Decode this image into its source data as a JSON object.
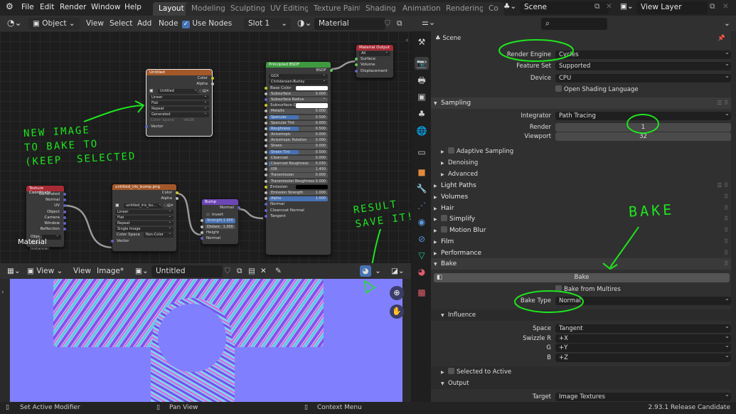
{
  "topbar": {
    "menus": [
      "File",
      "Edit",
      "Render",
      "Window",
      "Help"
    ],
    "workspaces": [
      {
        "label": "Layout",
        "active": true
      },
      {
        "label": "Modeling"
      },
      {
        "label": "Sculpting"
      },
      {
        "label": "UV Editing"
      },
      {
        "label": "Texture Paint"
      },
      {
        "label": "Shading"
      },
      {
        "label": "Animation"
      },
      {
        "label": "Rendering"
      },
      {
        "label": "Co"
      }
    ],
    "scene": "Scene",
    "view_layer": "View Layer"
  },
  "node_header": {
    "mode": "Object",
    "menus": [
      "View",
      "Select",
      "Add",
      "Node"
    ],
    "use_nodes_label": "Use Nodes",
    "use_nodes": true,
    "slot": "Slot 1",
    "material": "Material"
  },
  "nodes": {
    "untitled": {
      "title": "Untitled",
      "outputs": [
        "Color",
        "Alpha"
      ],
      "image": "Untitled",
      "interpolation": "Linear",
      "projection": "Flat",
      "extension": "Repeat",
      "source": "Generated",
      "color_space_label": "Color Space",
      "color_space": "sRGB",
      "input": "Vector"
    },
    "principled": {
      "title": "Principled BSDF",
      "output": "BSDF",
      "distribution": "GGX",
      "subsurface_method": "Christensen-Burley",
      "rows": [
        {
          "label": "Base Color",
          "type": "color"
        },
        {
          "label": "Subsurface",
          "value": "0.000"
        },
        {
          "label": "Subsurface Radius",
          "type": "dd"
        },
        {
          "label": "Subsurface C...",
          "type": "color"
        },
        {
          "label": "Metallic",
          "value": "0.000"
        },
        {
          "label": "Specular",
          "value": "0.500",
          "fill": 0.5
        },
        {
          "label": "Specular Tint",
          "value": "0.000"
        },
        {
          "label": "Roughness",
          "value": "0.500",
          "fill": 0.5
        },
        {
          "label": "Anisotropic",
          "value": "0.000"
        },
        {
          "label": "Anisotropic Rotation",
          "value": "0.000"
        },
        {
          "label": "Sheen",
          "value": "0.000"
        },
        {
          "label": "Sheen Tint",
          "value": "0.500",
          "fill": 0.5
        },
        {
          "label": "Clearcoat",
          "value": "0.000"
        },
        {
          "label": "Clearcoat Roughness",
          "value": "0.030",
          "fill": 0.03
        },
        {
          "label": "IOR",
          "value": "1.450"
        },
        {
          "label": "Transmission",
          "value": "0.000"
        },
        {
          "label": "Transmission Roughness",
          "value": "0.000"
        },
        {
          "label": "Emission",
          "type": "black"
        },
        {
          "label": "Emission Strength",
          "value": "1.000"
        },
        {
          "label": "Alpha",
          "value": "1.000",
          "fill": 1
        },
        {
          "label": "Normal",
          "type": "plain"
        },
        {
          "label": "Clearcoat Normal",
          "type": "plain"
        },
        {
          "label": "Tangent",
          "type": "plain"
        }
      ]
    },
    "output": {
      "title": "Material Output",
      "target": "All",
      "inputs": [
        "Surface",
        "Volume",
        "Displacement"
      ]
    },
    "texcoord": {
      "title": "Texture Coordinate",
      "outputs": [
        "Generated",
        "Normal",
        "UV",
        "Object",
        "Camera",
        "Window",
        "Reflection"
      ],
      "object_label": "Obje...",
      "from_instancer": "From Instancer"
    },
    "bumpimg": {
      "title": "untitled_iris_bump.png",
      "outputs": [
        "Color",
        "Alpha"
      ],
      "image": "untitled_iris_bu...",
      "interpolation": "Linear",
      "projection": "Flat",
      "extension": "Repeat",
      "source": "Single Image",
      "color_space_label": "Color Space",
      "color_space": "Non-Color",
      "input": "Vector"
    },
    "bump": {
      "title": "Bump",
      "output": "Normal",
      "invert": "Invert",
      "strength_label": "Strength",
      "strength": "1.000",
      "distance_label": "Distanc",
      "distance": "1.000",
      "inputs": [
        "Height",
        "Normal"
      ]
    }
  },
  "node_canvas_label": "Material",
  "annotations": {
    "new_image": "NEW IMAGE\nTO BAKE TO\n(KEEP  SELECTED",
    "result": "RESULT\nSAVE IT!",
    "bake": "BAKE"
  },
  "image_header": {
    "menus": [
      "View",
      "View",
      "Image*"
    ],
    "image_name": "Untitled"
  },
  "properties": {
    "context": "Scene",
    "render_engine_label": "Render Engine",
    "render_engine": "Cycles",
    "feature_set_label": "Feature Set",
    "feature_set": "Supported",
    "device_label": "Device",
    "device": "CPU",
    "osl_label": "Open Shading Language",
    "sampling": {
      "title": "Sampling",
      "integrator_label": "Integrator",
      "integrator": "Path Tracing",
      "render_label": "Render",
      "render": "1",
      "viewport_label": "Viewport",
      "viewport": "32",
      "subpanels": [
        "Adaptive Sampling",
        "Denoising",
        "Advanced"
      ]
    },
    "panels": [
      "Light Paths",
      "Volumes",
      "Hair",
      "Simplify",
      "Motion Blur",
      "Film",
      "Performance"
    ],
    "bake": {
      "title": "Bake",
      "button": "Bake",
      "multires_label": "Bake from Multires",
      "type_label": "Bake Type",
      "type": "Normal",
      "influence": {
        "title": "Influence",
        "space_label": "Space",
        "space": "Tangent",
        "swizzle_r_label": "Swizzle R",
        "swizzle_r": "+X",
        "g_label": "G",
        "g": "+Y",
        "b_label": "B",
        "b": "+Z"
      },
      "selected_to_active": "Selected to Active",
      "output": {
        "title": "Output",
        "target_label": "Target",
        "target": "Image Textures"
      }
    }
  },
  "status": {
    "left": "Set Active Modifier",
    "middle": "Pan View",
    "right": "Context Menu",
    "version": "2.93.1 Release Candidate"
  }
}
